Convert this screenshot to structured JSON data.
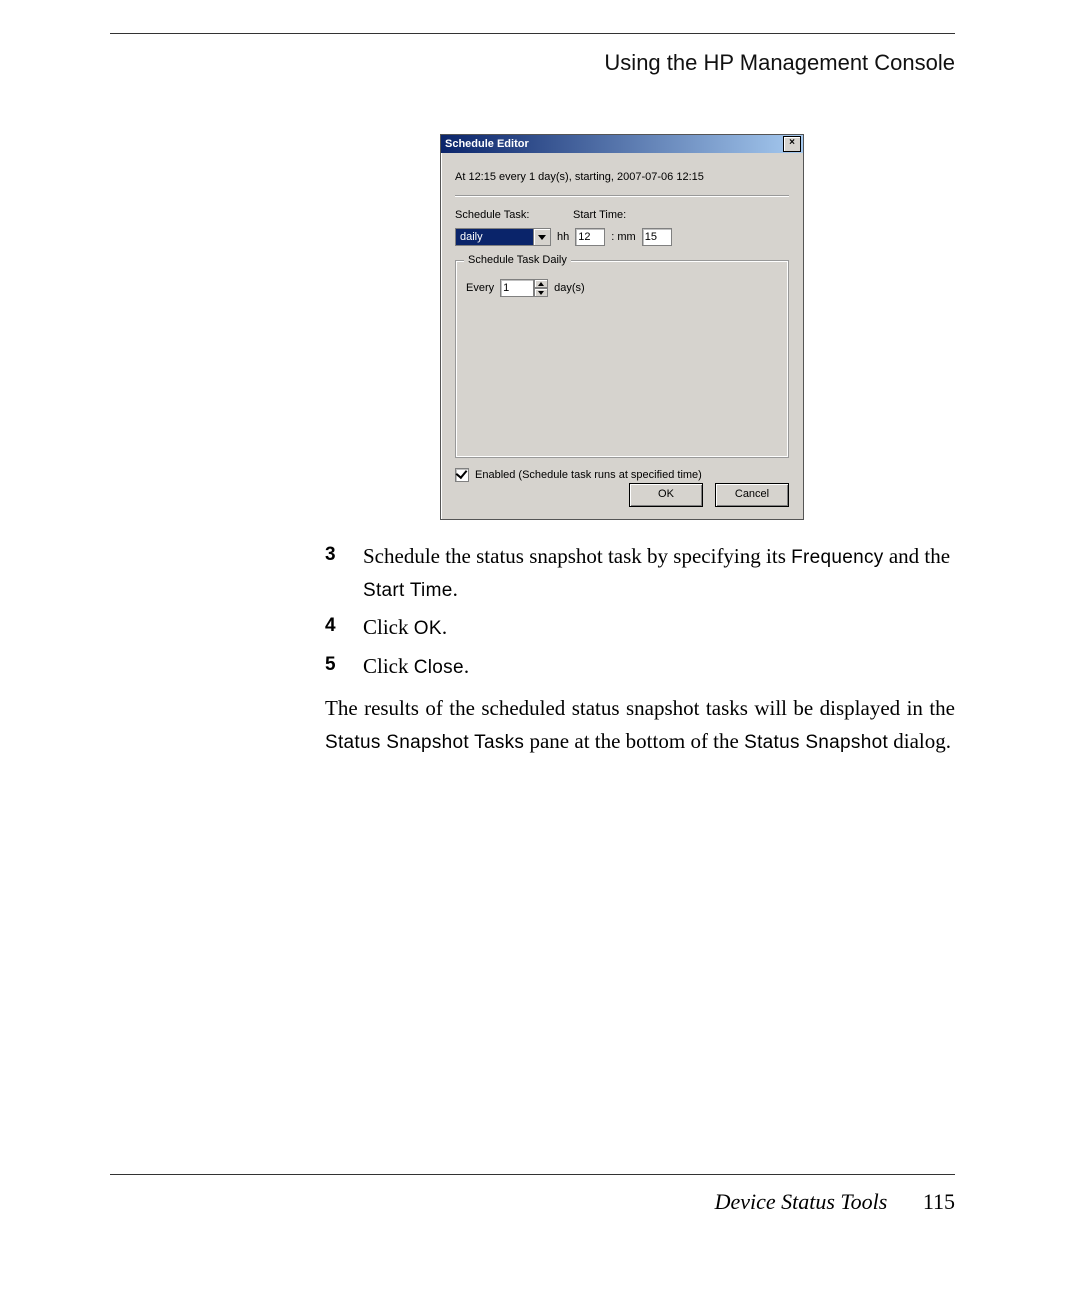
{
  "header": {
    "running": "Using the HP Management Console"
  },
  "dialog": {
    "title": "Schedule Editor",
    "summary": "At 12:15 every 1 day(s), starting, 2007-07-06 12:15",
    "labels": {
      "schedule_task": "Schedule Task:",
      "start_time": "Start Time:",
      "hh": "hh",
      "mm": ": mm",
      "group": "Schedule Task Daily",
      "every": "Every",
      "days": "day(s)",
      "enabled": "Enabled (Schedule task runs at specified time)"
    },
    "values": {
      "combo": "daily",
      "hh": "12",
      "mm": "15",
      "every": "1"
    },
    "buttons": {
      "ok": "OK",
      "cancel": "Cancel"
    }
  },
  "steps": {
    "s3": {
      "num": "3",
      "pre": "Schedule the status snapshot task by specifying its ",
      "t1": "Frequency",
      "mid": " and the ",
      "t2": "Start Time",
      "post": "."
    },
    "s4": {
      "num": "4",
      "pre": "Click ",
      "t1": "OK",
      "post": "."
    },
    "s5": {
      "num": "5",
      "pre": "Click ",
      "t1": "Close",
      "post": "."
    }
  },
  "para": {
    "a": "The results of the scheduled status snapshot tasks will be displayed in the ",
    "t1": "Status Snapshot Tasks",
    "b": " pane at the bottom of the ",
    "t2": "Status Snap­shot",
    "c": " dialog."
  },
  "footer": {
    "title": "Device Status Tools",
    "page": "115"
  }
}
